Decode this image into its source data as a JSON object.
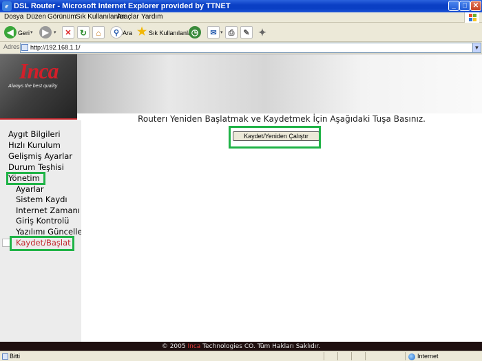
{
  "window": {
    "title": "DSL Router - Microsoft Internet Explorer provided by TTNET",
    "minimize": "_",
    "maximize": "□",
    "close": "✕"
  },
  "menu": [
    "Dosya",
    "Düzen",
    "Görünüm",
    "Sık Kullanılanlar",
    "Araçlar",
    "Yardım"
  ],
  "toolbar": {
    "back_label": "Geri",
    "search_label": "Ara",
    "favorites_label": "Sık Kullanılanlar"
  },
  "address": {
    "label": "Adres",
    "url": "http://192.168.1.1/"
  },
  "banner": {
    "logo": "Inca",
    "tagline": "Always the best quality"
  },
  "nav": {
    "items": [
      {
        "label": "Aygıt Bilgileri"
      },
      {
        "label": "Hızlı Kurulum"
      },
      {
        "label": "Gelişmiş Ayarlar"
      },
      {
        "label": "Durum Teşhisi"
      },
      {
        "label": "Yönetim"
      },
      {
        "label": "Ayarlar"
      },
      {
        "label": "Sistem Kaydı"
      },
      {
        "label": "Internet Zamanı"
      },
      {
        "label": "Giriş Kontrolü"
      },
      {
        "label": "Yazılımı Güncelle"
      },
      {
        "label": "Kaydet/Başlat"
      }
    ]
  },
  "main": {
    "heading": "Routerı Yeniden Başlatmak ve Kaydetmek İçin Aşağıdaki Tuşa Basınız.",
    "button_label": "Kaydet/Yeniden Çalıştır"
  },
  "footer": {
    "prefix": "© 2005 ",
    "brand": "Inca",
    "suffix": " Technologies CO. Tüm Hakları Saklıdır."
  },
  "status": {
    "left": "Bitti",
    "zone": "Internet"
  },
  "colors": {
    "highlight": "#1fb346",
    "active_nav": "#c1272d",
    "brand_red": "#d21f2a",
    "footer_bg": "#1e0f0f"
  }
}
